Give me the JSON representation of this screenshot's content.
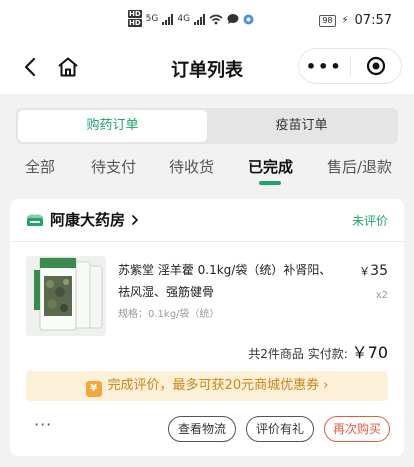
{
  "status_bar": {
    "time": "07:57",
    "battery": "98",
    "signal_5g": "5G",
    "signal_4g": "4G",
    "hd": [
      "HD",
      "HD"
    ]
  },
  "nav": {
    "title": "订单列表",
    "more": "•••"
  },
  "segment_tabs": [
    {
      "label": "购药订单",
      "active": true
    },
    {
      "label": "疫苗订单",
      "active": false
    }
  ],
  "status_tabs": [
    {
      "label": "全部"
    },
    {
      "label": "待支付"
    },
    {
      "label": "待收货"
    },
    {
      "label": "已完成"
    },
    {
      "label": "售后/退款"
    }
  ],
  "order": {
    "store_name": "阿康大药房",
    "status": "未评价",
    "product": {
      "name": "苏紫堂 淫羊藿 0.1kg/袋（统）补肾阳、祛风湿、强筋健骨",
      "spec": "规格：0.1kg/袋（统）",
      "price_symbol": "￥",
      "price": "35",
      "quantity": "x2"
    },
    "summary_prefix": "共2件商品  实付款:",
    "total_symbol": "￥",
    "total": "70",
    "banner": {
      "coin": "¥",
      "text": "完成评价，最多可获20元商城优惠券",
      "arrow": "›"
    },
    "more_dots": "···",
    "buttons": {
      "logistics": "查看物流",
      "review": "评价有礼",
      "rebuy": "再次购买"
    }
  },
  "colors": {
    "accent_green": "#1fa56b",
    "rebuy_red": "#e35d42",
    "banner_bg": "#fdf0d8",
    "banner_text": "#c9861a"
  }
}
